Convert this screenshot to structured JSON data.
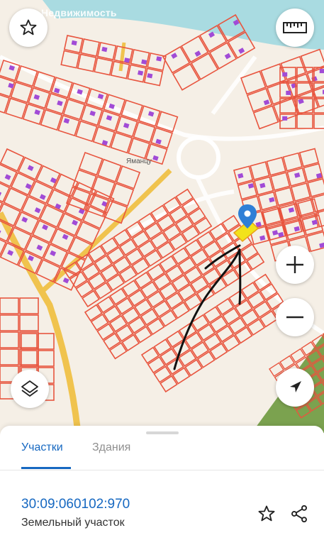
{
  "map": {
    "watermark": "Недвижимость",
    "place_label": "Яманцу"
  },
  "controls": {
    "favorite_icon": "star-icon",
    "ruler_icon": "ruler-icon",
    "zoom_in_icon": "plus-icon",
    "zoom_out_icon": "minus-icon",
    "layers_icon": "layers-icon",
    "location_icon": "navigation-arrow-icon"
  },
  "sheet": {
    "tabs": [
      {
        "label": "Участки",
        "active": true
      },
      {
        "label": "Здания",
        "active": false
      }
    ],
    "parcel": {
      "cadastral_number": "30:09:060102:970",
      "type": "Земельный участок"
    },
    "actions": {
      "favorite_icon": "star-outline-icon",
      "share_icon": "share-icon"
    }
  },
  "colors": {
    "accent": "#1668c1",
    "parcel_outline": "#e8553f",
    "building": "#a14bd6",
    "selected_parcel": "#f2e21b",
    "road_yellow": "#f0c34e",
    "water": "#a9dbe1",
    "green_area": "#7ba24f"
  }
}
